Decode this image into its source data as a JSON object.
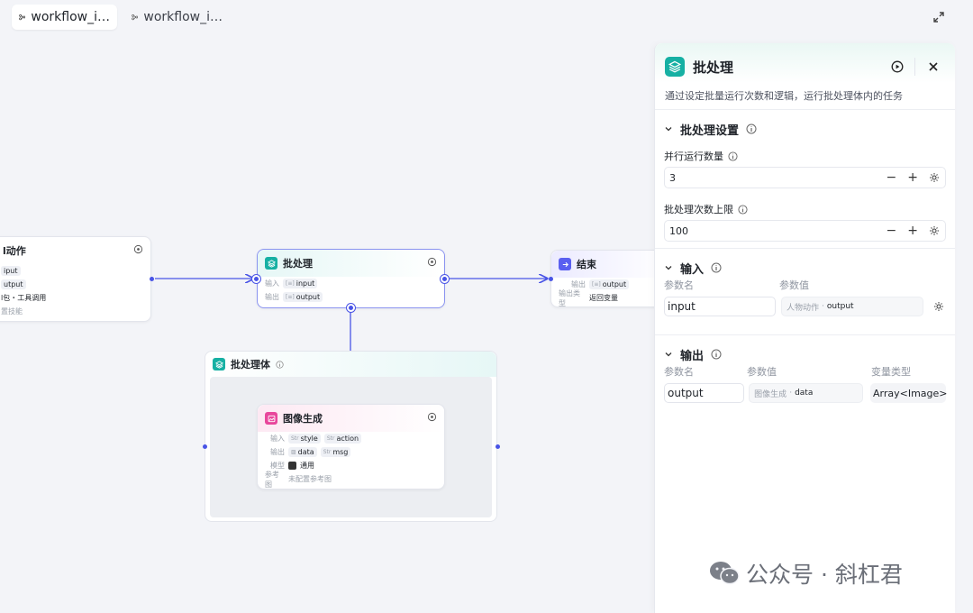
{
  "tabs": [
    {
      "label": "workflow_i…",
      "active": true
    },
    {
      "label": "workflow_i…",
      "active": false
    }
  ],
  "nodes": {
    "action": {
      "title": "l动作",
      "row1": "iput",
      "row2": "utput",
      "row3": "l包・工具调用",
      "row4": "置技能"
    },
    "batch": {
      "title": "批处理",
      "in_label": "输入",
      "in_chip": "input",
      "out_label": "输出",
      "out_chip": "output"
    },
    "end": {
      "title": "结束",
      "out_label": "输出",
      "out_chip": "output",
      "type_label": "输出类型",
      "type_value": "返回变量"
    },
    "batch_body": {
      "title": "批处理体"
    },
    "image_gen": {
      "title": "图像生成",
      "in_label": "输入",
      "in_chips": [
        "style",
        "action"
      ],
      "out_label": "输出",
      "out_chips": [
        "data",
        "msg"
      ],
      "model_label": "模型",
      "model_value": "通用",
      "ref_label": "参考图",
      "ref_value": "未配置参考图"
    }
  },
  "panel": {
    "title": "批处理",
    "description": "通过设定批量运行次数和逻辑，运行批处理体内的任务",
    "settings": {
      "title": "批处理设置",
      "parallel_label": "并行运行数量",
      "parallel_value": "3",
      "limit_label": "批处理次数上限",
      "limit_value": "100"
    },
    "inputs": {
      "title": "输入",
      "col_name": "参数名",
      "col_value": "参数值",
      "param_name": "input",
      "ref_source": "人物动作",
      "ref_var": "output"
    },
    "outputs": {
      "title": "输出",
      "col_name": "参数名",
      "col_value": "参数值",
      "col_type": "变量类型",
      "param_name": "output",
      "ref_source": "图像生成",
      "ref_var": "data",
      "var_type": "Array<Image>"
    }
  },
  "watermark": "公众号 · 斜杠君",
  "colors": {
    "accent": "#4954e6",
    "teal": "#16b0a3",
    "pink": "#e8479c"
  }
}
